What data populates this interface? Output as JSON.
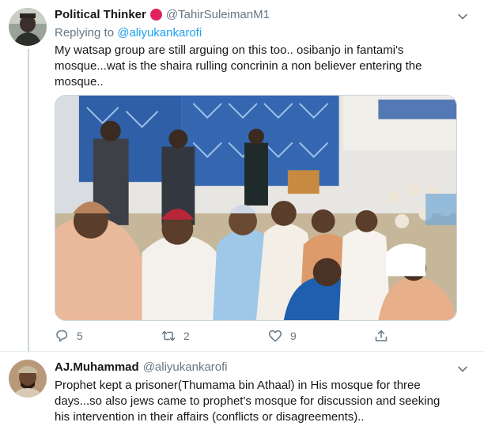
{
  "tweet1": {
    "author": {
      "name": "Political Thinker",
      "handle": "@TahirSuleimanM1"
    },
    "replying_prefix": "Replying to",
    "replying_handle": "@aliyukankarofi",
    "text": "My watsap group are still arguing on this too.. osibanjo in fantami's mosque...wat is the shaira rulling concrinin a non believer entering the mosque..",
    "image_icon": "photo-mosque-gathering",
    "actions": {
      "replies": "5",
      "retweets": "2",
      "likes": "9"
    },
    "icons": {
      "reply": "reply-icon",
      "retweet": "retweet-icon",
      "like": "heart-icon",
      "share": "share-icon",
      "more": "chevron-down-icon"
    }
  },
  "tweet2": {
    "author": {
      "name": "AJ.Muhammad",
      "handle": "@aliyukankarofi"
    },
    "text": "Prophet kept a prisoner(Thumama bin Athaal) in His mosque for three days...so also jews came to prophet's mosque for discussion and seeking his intervention in their affairs (conflicts or disagreements).."
  },
  "colors": {
    "link": "#1da1f2",
    "badge": "#e0245e",
    "muted": "#657786",
    "thread_line": "#ccd6dd"
  }
}
